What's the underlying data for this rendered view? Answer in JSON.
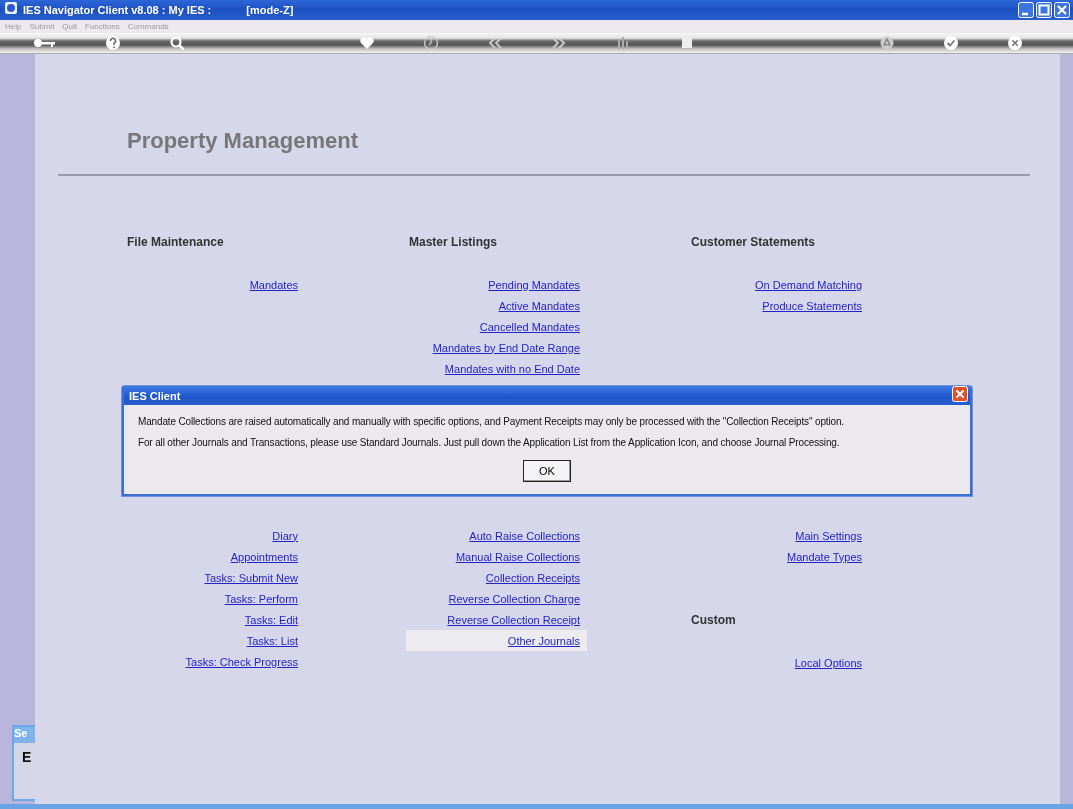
{
  "window": {
    "title": "IES Navigator Client v8.08 : My IES :",
    "mode": "[mode-Z]"
  },
  "menu": [
    "Help",
    "Submit",
    "Quit",
    "Functions",
    "Commands"
  ],
  "toolbar": [
    {
      "tools": [
        {
          "kind": "key"
        },
        {
          "kind": "help"
        },
        {
          "kind": "search"
        }
      ]
    },
    {
      "tools": [
        {
          "kind": "heart"
        },
        {
          "kind": "clock"
        },
        {
          "kind": "back"
        },
        {
          "kind": "forward"
        },
        {
          "kind": "bars"
        },
        {
          "kind": "stop"
        }
      ]
    },
    {
      "tools": [
        {
          "kind": "recycle"
        },
        {
          "kind": "ok"
        },
        {
          "kind": "cancel"
        }
      ]
    }
  ],
  "page_title": "Property Management",
  "sections": [
    {
      "columns": [
        {
          "heading": "File Maintenance",
          "links": [
            {
              "label": "Mandates",
              "selected": false
            }
          ]
        },
        {
          "heading": "Master Listings",
          "links": [
            {
              "label": "Pending Mandates",
              "selected": false
            },
            {
              "label": "Active Mandates",
              "selected": false
            },
            {
              "label": "Cancelled Mandates",
              "selected": false
            },
            {
              "label": "Mandates by End Date Range",
              "selected": false
            },
            {
              "label": "Mandates with no End Date",
              "selected": false
            }
          ]
        },
        {
          "heading": "Customer Statements",
          "links": [
            {
              "label": "On Demand Matching",
              "selected": false
            },
            {
              "label": "Produce Statements",
              "selected": false
            }
          ]
        }
      ]
    },
    {
      "columns": [
        {
          "links": [
            {
              "label": "Diary",
              "selected": false
            },
            {
              "label": "Appointments",
              "selected": false
            },
            {
              "label": "Tasks: Submit New",
              "selected": false
            },
            {
              "label": "Tasks: Perform",
              "selected": false
            },
            {
              "label": "Tasks: Edit",
              "selected": false
            },
            {
              "label": "Tasks: List",
              "selected": false
            },
            {
              "label": "Tasks: Check Progress",
              "selected": false
            }
          ]
        },
        {
          "links": [
            {
              "label": "Auto Raise Collections",
              "selected": false
            },
            {
              "label": "Manual Raise Collections",
              "selected": false
            },
            {
              "label": "Collection Receipts",
              "selected": false
            },
            {
              "label": "Reverse Collection Charge",
              "selected": false
            },
            {
              "label": "Reverse Collection Receipt",
              "selected": false
            },
            {
              "label": "Other Journals",
              "selected": true
            }
          ]
        },
        {
          "links": [
            {
              "label": "Main Settings",
              "selected": false
            },
            {
              "label": "Mandate Types",
              "selected": false
            }
          ],
          "subgroup": {
            "heading": "Custom",
            "links": [
              {
                "label": "Local Options",
                "selected": false
              }
            ]
          }
        }
      ]
    }
  ],
  "side_panel": {
    "title": "Se",
    "text": "E"
  },
  "dialog": {
    "title": "IES Client",
    "lines": [
      "Mandate Collections are raised automatically and manually with specific options, and Payment Receipts may only be processed with the \"Collection Receipts\" option.",
      "For all other Journals and Transactions, please use Standard Journals. Just pull down the Application List from the Application Icon, and choose Journal Processing."
    ],
    "button": "OK"
  }
}
